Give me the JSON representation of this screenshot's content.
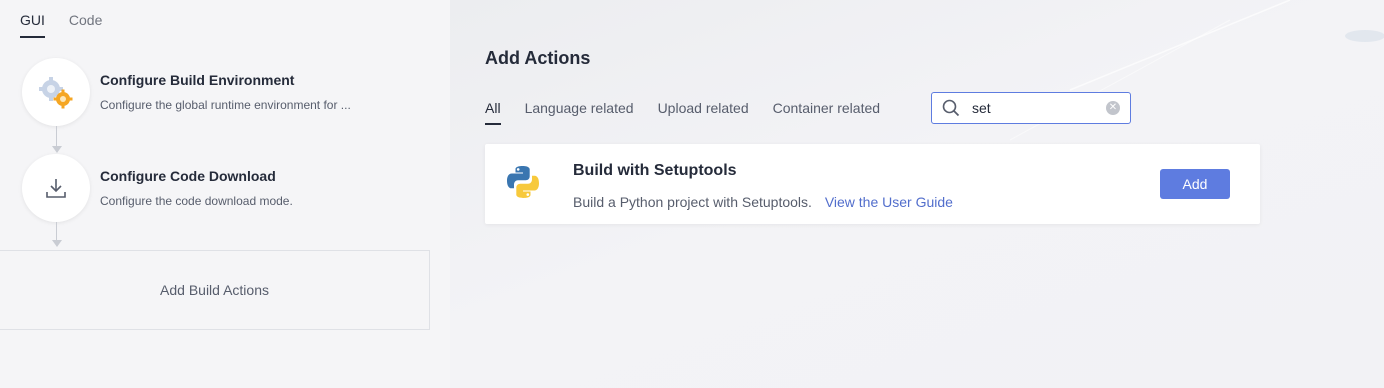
{
  "mode_tabs": [
    {
      "label": "GUI",
      "active": true
    },
    {
      "label": "Code",
      "active": false
    }
  ],
  "steps": [
    {
      "icon": "gears-icon",
      "title": "Configure Build Environment",
      "description": "Configure the global runtime environment for ..."
    },
    {
      "icon": "download-icon",
      "title": "Configure Code Download",
      "description": "Configure the code download mode."
    }
  ],
  "add_build_actions_label": "Add Build Actions",
  "panel": {
    "title": "Add Actions",
    "filter_tabs": [
      {
        "label": "All",
        "active": true
      },
      {
        "label": "Language related",
        "active": false
      },
      {
        "label": "Upload related",
        "active": false
      },
      {
        "label": "Container related",
        "active": false
      }
    ],
    "search": {
      "value": "set",
      "placeholder": ""
    },
    "results": [
      {
        "icon": "python-icon",
        "title": "Build with Setuptools",
        "description": "Build a Python project with Setuptools.",
        "link_label": "View the User Guide",
        "button_label": "Add"
      }
    ]
  },
  "colors": {
    "accent": "#5e7ce0",
    "link": "#526ecc",
    "text_primary": "#252b3a",
    "text_secondary": "#575d6c"
  }
}
